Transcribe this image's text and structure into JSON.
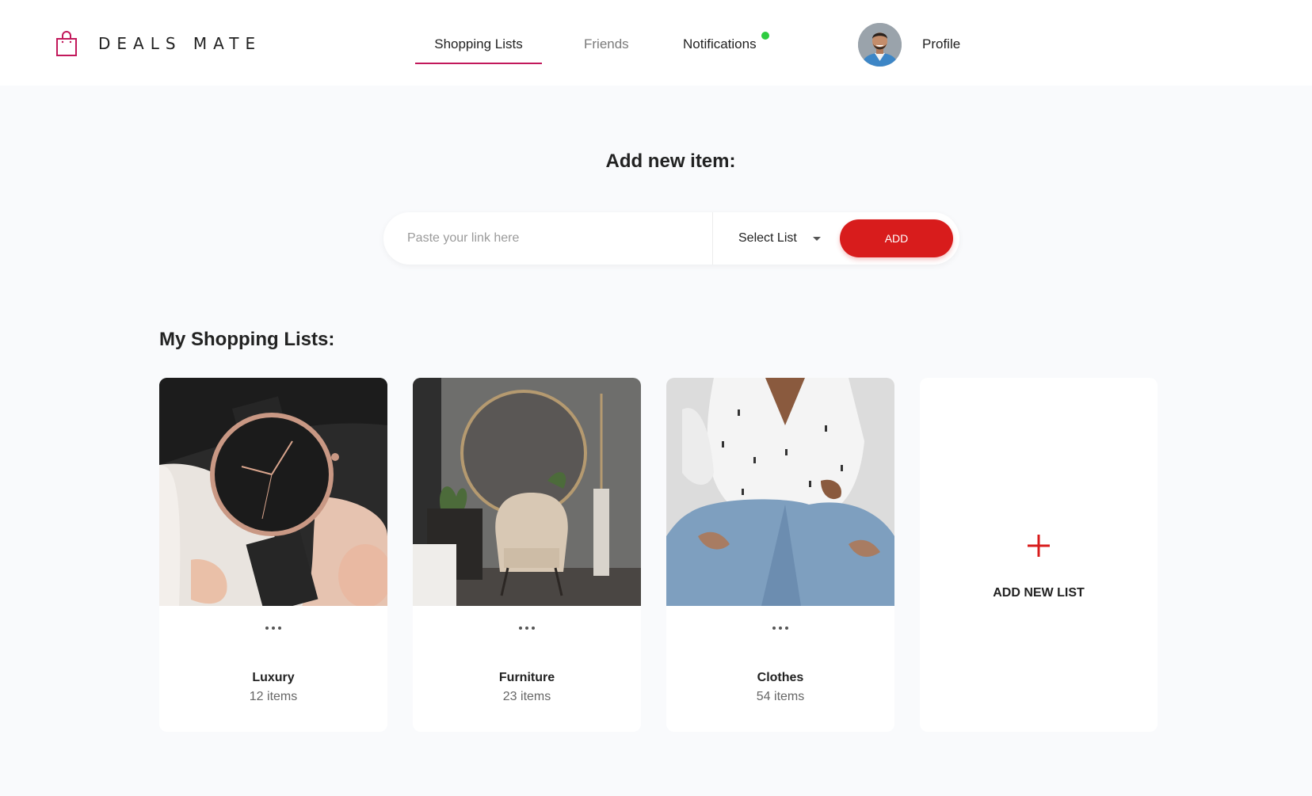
{
  "header": {
    "logo_text": "DEALS MATE",
    "nav": {
      "shopping_lists": "Shopping Lists",
      "friends": "Friends",
      "notifications": "Notifications",
      "profile": "Profile"
    },
    "notification_dot_color": "#2ecc40",
    "active_tab_underline_color": "#c2185b"
  },
  "add_item": {
    "title": "Add new item:",
    "link_placeholder": "Paste your link here",
    "link_value": "",
    "select_label": "Select List",
    "add_label": "ADD",
    "accent_color": "#d81c1c"
  },
  "lists": {
    "title": "My Shopping Lists:",
    "items": [
      {
        "name": "Luxury",
        "count": "12 items",
        "image": "wristwatch-photo"
      },
      {
        "name": "Furniture",
        "count": "23 items",
        "image": "armchair-mirror-photo"
      },
      {
        "name": "Clothes",
        "count": "54 items",
        "image": "shirt-jeans-photo"
      }
    ],
    "add_new_label": "ADD NEW LIST"
  }
}
